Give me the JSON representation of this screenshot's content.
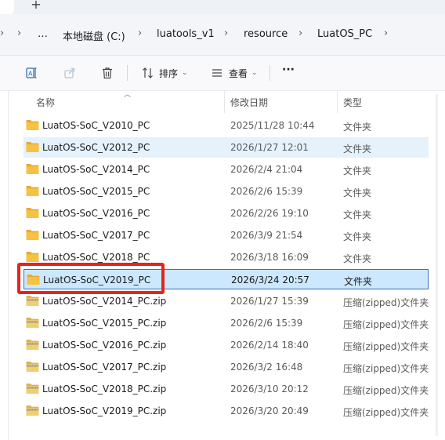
{
  "tabstrip": {
    "new_tab": "+"
  },
  "breadcrumb": {
    "items": [
      "…",
      "本地磁盘 (C:)",
      "luatools_v1",
      "resource",
      "LuatOS_PC"
    ]
  },
  "toolbar": {
    "sort_label": "排序",
    "view_label": "查看",
    "more": "···"
  },
  "columns": {
    "name": "名称",
    "date": "修改日期",
    "type": "类型"
  },
  "rows": [
    {
      "icon": "folder-icon",
      "name": "LuatOS-SoC_V2010_PC",
      "date": "2025/11/28 10:44",
      "type": "文件夹",
      "state": ""
    },
    {
      "icon": "folder-icon",
      "name": "LuatOS-SoC_V2012_PC",
      "date": "2026/1/27 12:01",
      "type": "文件夹",
      "state": "hover"
    },
    {
      "icon": "folder-icon",
      "name": "LuatOS-SoC_V2014_PC",
      "date": "2026/2/4 21:04",
      "type": "文件夹",
      "state": ""
    },
    {
      "icon": "folder-icon",
      "name": "LuatOS-SoC_V2015_PC",
      "date": "2026/2/6 15:39",
      "type": "文件夹",
      "state": ""
    },
    {
      "icon": "folder-icon",
      "name": "LuatOS-SoC_V2016_PC",
      "date": "2026/2/26 19:10",
      "type": "文件夹",
      "state": ""
    },
    {
      "icon": "folder-icon",
      "name": "LuatOS-SoC_V2017_PC",
      "date": "2026/3/9 21:54",
      "type": "文件夹",
      "state": ""
    },
    {
      "icon": "folder-icon",
      "name": "LuatOS-SoC_V2018_PC",
      "date": "2026/3/18 16:09",
      "type": "文件夹",
      "state": ""
    },
    {
      "icon": "folder-icon",
      "name": "LuatOS-SoC_V2019_PC",
      "date": "2026/3/24 20:57",
      "type": "文件夹",
      "state": "selected"
    },
    {
      "icon": "zip-icon",
      "name": "LuatOS-SoC_V2014_PC.zip",
      "date": "2026/1/27 15:39",
      "type": "压缩(zipped)文件夹",
      "state": ""
    },
    {
      "icon": "zip-icon",
      "name": "LuatOS-SoC_V2015_PC.zip",
      "date": "2026/2/6 15:39",
      "type": "压缩(zipped)文件夹",
      "state": ""
    },
    {
      "icon": "zip-icon",
      "name": "LuatOS-SoC_V2016_PC.zip",
      "date": "2026/2/14 18:40",
      "type": "压缩(zipped)文件夹",
      "state": ""
    },
    {
      "icon": "zip-icon",
      "name": "LuatOS-SoC_V2017_PC.zip",
      "date": "2026/3/2 16:48",
      "type": "压缩(zipped)文件夹",
      "state": ""
    },
    {
      "icon": "zip-icon",
      "name": "LuatOS-SoC_V2018_PC.zip",
      "date": "2026/3/10 20:12",
      "type": "压缩(zipped)文件夹",
      "state": ""
    },
    {
      "icon": "zip-icon",
      "name": "LuatOS-SoC_V2019_PC.zip",
      "date": "2026/3/20 20:49",
      "type": "压缩(zipped)文件夹",
      "state": ""
    }
  ],
  "colors": {
    "selected_bg": "#cce8ff",
    "hover_bg": "#e5f1fb",
    "highlight_border": "#e5241b",
    "folder": "#f5c242"
  }
}
